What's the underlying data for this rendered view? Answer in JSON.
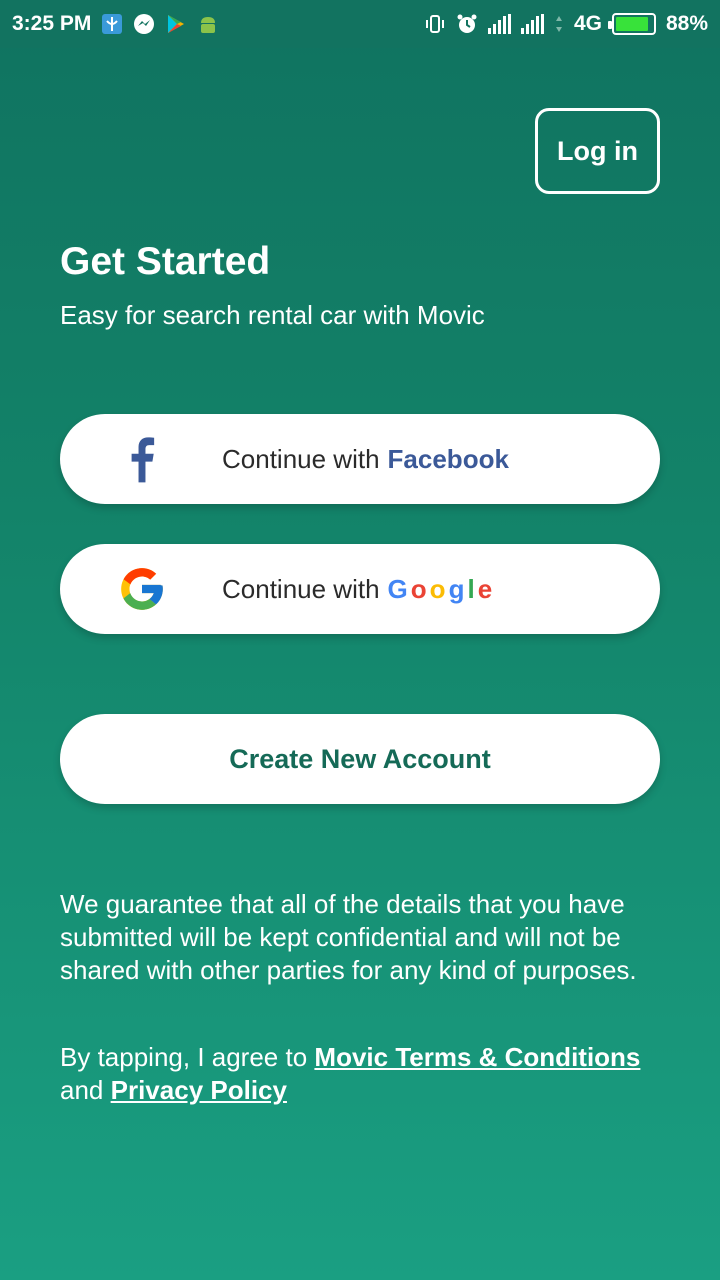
{
  "status_bar": {
    "time": "3:25 PM",
    "network": "4G",
    "battery": "88%",
    "battery_level": 0.88,
    "icons_left": [
      "vpn-icon",
      "messenger-icon",
      "play-store-icon",
      "android-icon"
    ],
    "icons_right": [
      "vibrate-icon",
      "alarm-icon",
      "signal-icon",
      "signal-icon",
      "data-arrows-icon",
      "battery-icon"
    ]
  },
  "header": {
    "login_label": "Log in"
  },
  "intro": {
    "title": "Get Started",
    "subtitle": "Easy for search rental car with Movic"
  },
  "facebook_button": {
    "prefix": "Continue with",
    "brand": "Facebook",
    "brand_color": "#3b5998",
    "icon": "facebook-icon"
  },
  "google_button": {
    "prefix": "Continue with",
    "brand_letters": [
      "G",
      "o",
      "o",
      "g",
      "l",
      "e"
    ],
    "brand_colors": [
      "#4285F4",
      "#EA4335",
      "#FBBC05",
      "#4285F4",
      "#34A853",
      "#EA4335"
    ],
    "icon": "google-icon"
  },
  "create_account": {
    "label": "Create New Account",
    "color": "#156a57"
  },
  "footer": {
    "disclaimer": "We guarantee that all of the details that you have submitted will be kept confidential and will not be shared with other parties for any kind of purposes.",
    "terms_prefix": "By tapping, I agree to",
    "terms_link": "Movic Terms & Conditions",
    "terms_and": "and",
    "privacy_link": "Privacy Policy"
  },
  "colors": {
    "background_top": "#107360",
    "background_bottom": "#1a9f82",
    "status_bar": "#127360"
  }
}
